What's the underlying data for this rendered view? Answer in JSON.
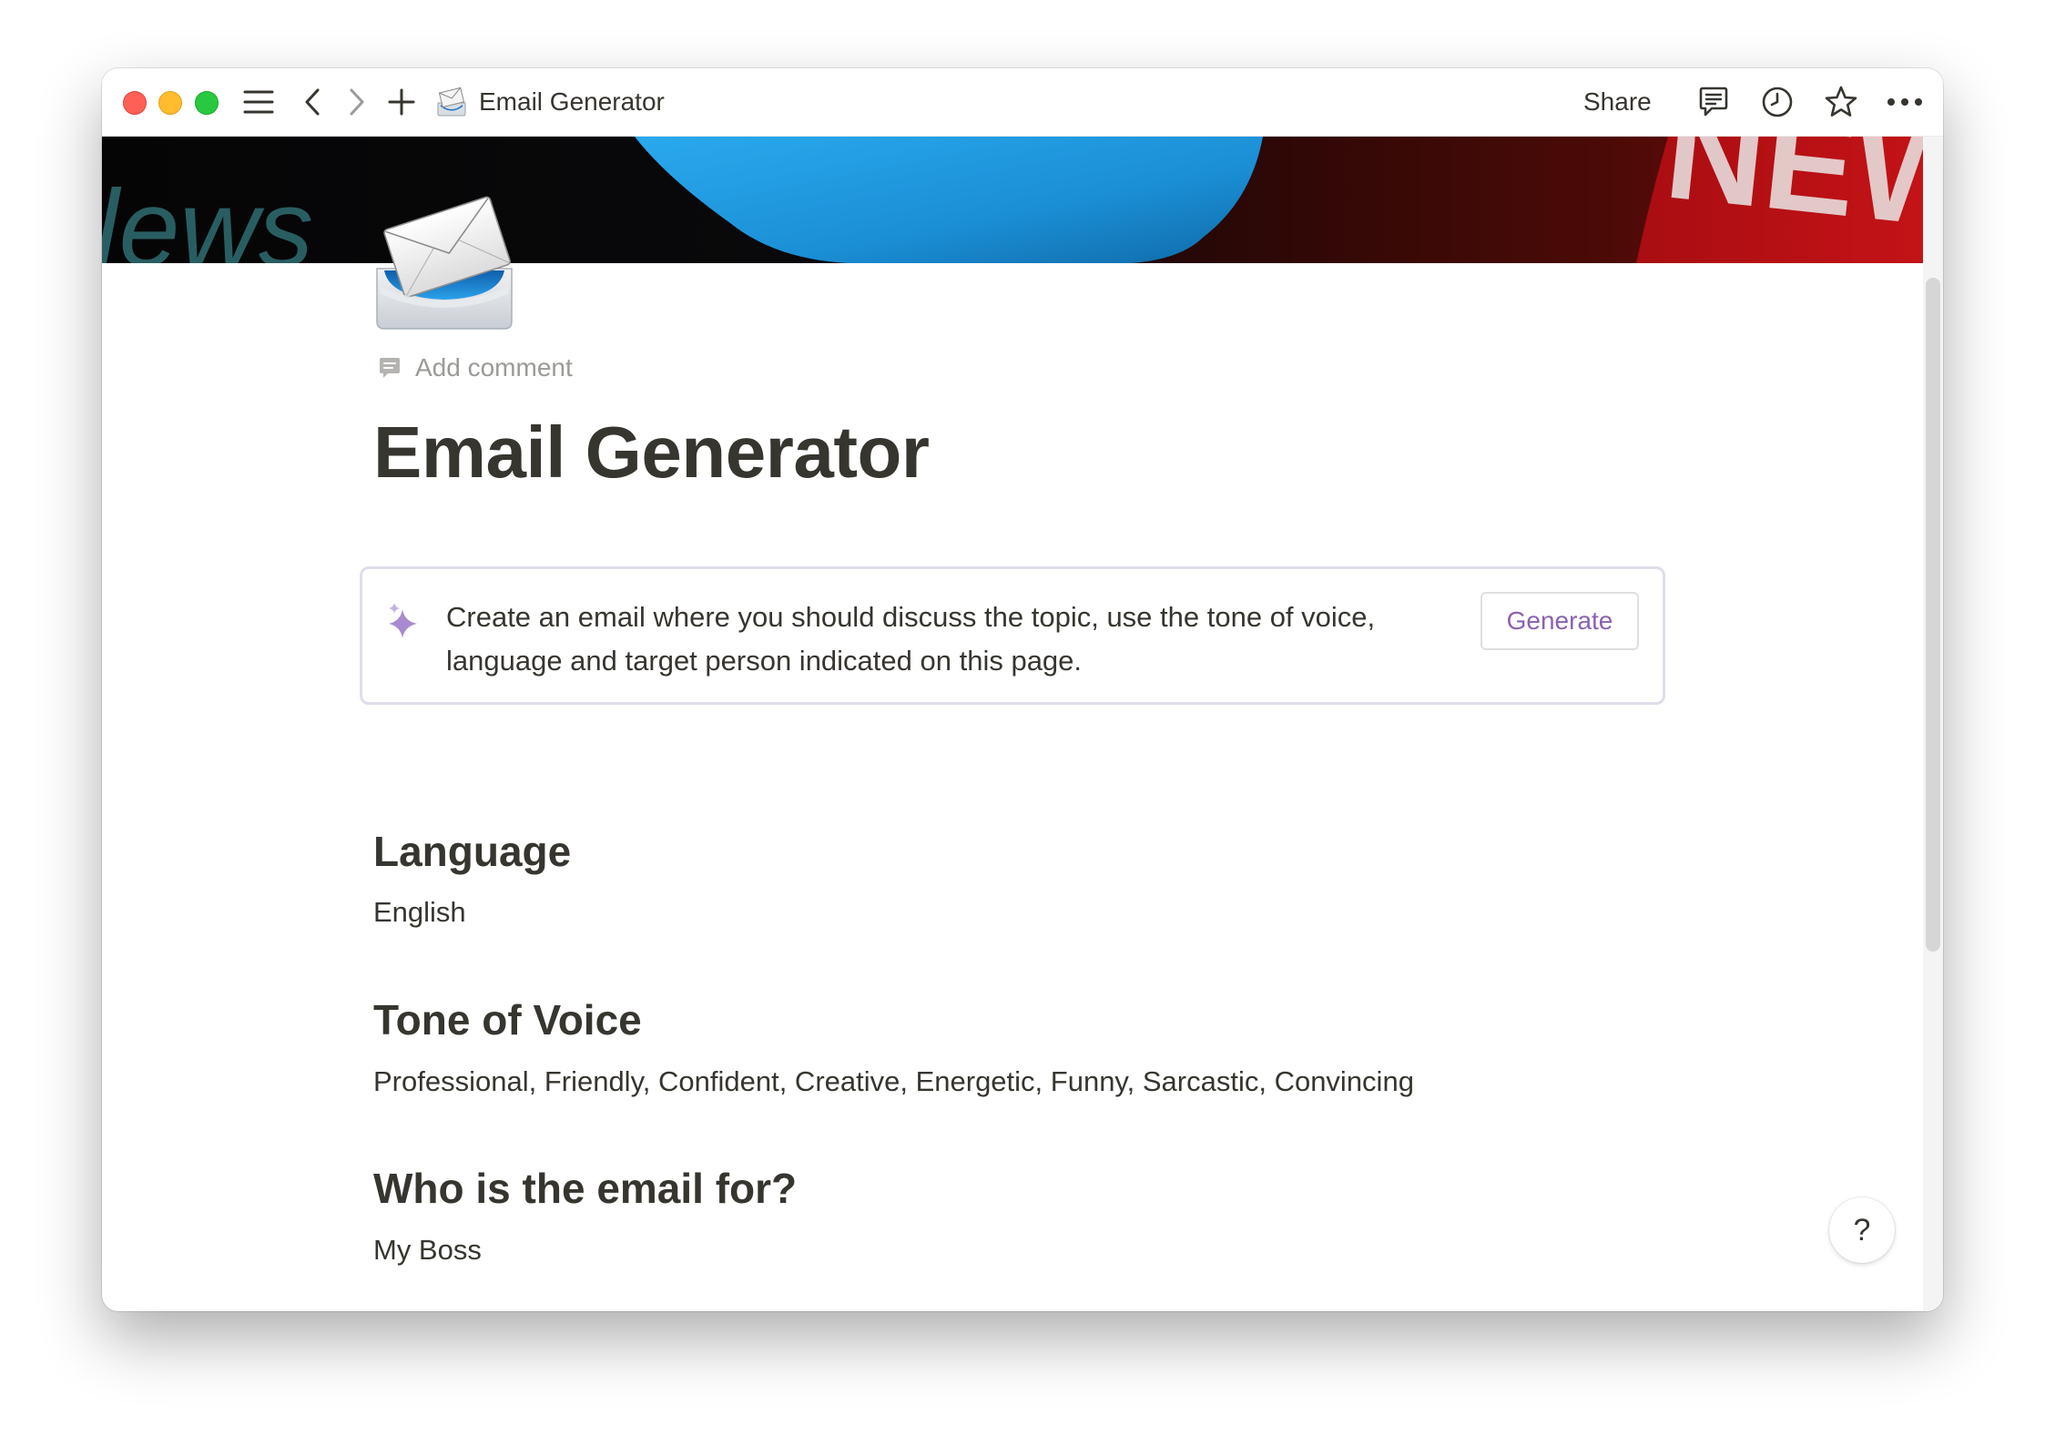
{
  "window": {
    "title": "Email Generator",
    "share_label": "Share"
  },
  "icons": {
    "page_icon": "incoming-envelope-tray-icon",
    "toolbar": [
      "sidebar-menu-icon",
      "back-arrow-icon",
      "forward-arrow-icon",
      "plus-icon",
      "comments-icon",
      "history-clock-icon",
      "star-icon",
      "more-dots-icon"
    ]
  },
  "page": {
    "add_comment_label": "Add comment",
    "title": "Email Generator"
  },
  "ai_block": {
    "prompt": "Create an email where you should discuss the topic, use the tone of voice, language and target person indicated on this page.",
    "button_label": "Generate",
    "accent_color": "#8a62b0"
  },
  "sections": [
    {
      "heading": "Language",
      "value": "English"
    },
    {
      "heading": "Tone of Voice",
      "value": "Professional, Friendly, Confident, Creative, Energetic, Funny, Sarcastic, Convincing"
    },
    {
      "heading": "Who is the email for?",
      "value": "My Boss"
    }
  ],
  "cover": {
    "text_left": "lews",
    "text_right": "NEW"
  },
  "help_label": "?"
}
